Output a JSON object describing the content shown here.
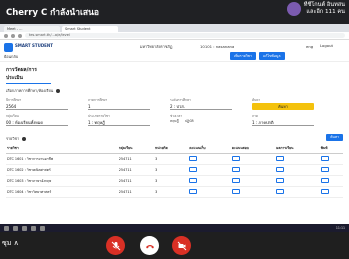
{
  "meet": {
    "presenter": "Cherry C กำลังนำเสนอ",
    "participant_line1": "ทีชีโกนต์ อินทสน",
    "participant_line2": "และอีก 111 คน",
    "bottom_label": "ซุม ∧"
  },
  "browser": {
    "tabs": [
      "Meet - ...",
      "Smart Student"
    ],
    "url": "tes.smart.th/...a/e/level"
  },
  "app": {
    "name": "SMART STUDENT",
    "school": "มหาวิทยาลัยราชภัฏ",
    "user_code": "10101 : nasanana",
    "lang": "eng",
    "logout": "Logout",
    "back": "ย้อนกลับ",
    "btn1": "เพิ่มรายวิชา",
    "btn2": "แก้ไขข้อมูล"
  },
  "panel": {
    "title": "การวัดผล/การประเมิน",
    "subtitle": "เลือกภาคการศึกษา/ห้องเรียน",
    "fields": [
      {
        "label": "ปีการศึกษา",
        "value": "2564"
      },
      {
        "label": "ภาคการศึกษา",
        "value": "1"
      },
      {
        "label": "ระดับการศึกษา",
        "value": "2 : ปวส."
      },
      {
        "label": "ค้นหา",
        "value": "ค้นหา"
      },
      {
        "label": "กลุ่มเรียน",
        "value": "00 : ห้องเรียนทั้งหมด"
      },
      {
        "label": "ประเภทรายวิชา",
        "value": "1 : ทฤษฎี"
      },
      {
        "label": "ช่วงเวลา",
        "value": "ทั้งหมด"
      },
      {
        "label": "ภาค",
        "value": "1 : ภาคปกติ"
      }
    ],
    "radios": [
      "ทฤษฎี",
      "ปฏิบัติ"
    ],
    "table_title": "รายวิชา",
    "search": "ค้นหา",
    "columns": [
      "รายวิชา",
      "กลุ่มเรียน",
      "หน่วยกิต",
      "คะแนนเก็บ",
      "คะแนนสอบ",
      "ผลการเรียน",
      "พิมพ์"
    ],
    "rows": [
      {
        "code": "DTC 1601 : วิชาการงานอาชีพ",
        "group": "254711",
        "credit": "3"
      },
      {
        "code": "DTC 1602 : วิชาคณิตศาสตร์",
        "group": "254711",
        "credit": "3"
      },
      {
        "code": "DTC 1603 : วิชาภาษาอังกฤษ",
        "group": "254711",
        "credit": "3"
      },
      {
        "code": "DTC 1604 : วิชาวิทยาศาสตร์",
        "group": "254711",
        "credit": "3"
      }
    ]
  },
  "taskbar": {
    "time": "11:11"
  }
}
